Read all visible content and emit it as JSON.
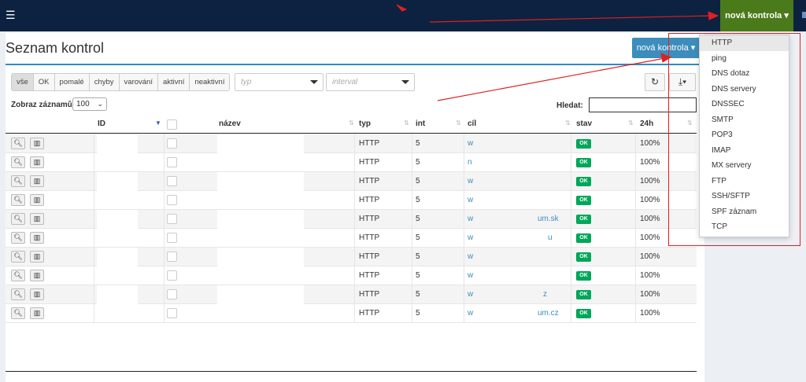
{
  "header": {
    "menu_icon": "hamburger-icon",
    "new_check_label": "nová kontrola",
    "chevron_icon": "chevron-down-icon"
  },
  "page": {
    "title": "Seznam kontrol",
    "new_check_button": "nová kontrola ▾"
  },
  "filters": [
    "vše",
    "OK",
    "pomalé",
    "chyby",
    "varování",
    "aktivní",
    "neaktivní"
  ],
  "active_filter": "vše",
  "selects": {
    "type_placeholder": "typ",
    "interval_placeholder": "interval"
  },
  "toolbar_icons": [
    "refresh-icon",
    "download-icon"
  ],
  "length": {
    "label": "Zobraz záznamů",
    "value": "100"
  },
  "search": {
    "label": "Hledat:",
    "value": ""
  },
  "table": {
    "columns": [
      "ID",
      "název",
      "typ",
      "int",
      "cíl",
      "stav",
      "24h"
    ],
    "rows": [
      {
        "typ": "HTTP",
        "int": "5",
        "cil": "w",
        "cil_suffix": "",
        "stav": "OK",
        "h24": "100%"
      },
      {
        "typ": "HTTP",
        "int": "5",
        "cil": "n",
        "cil_suffix": "",
        "stav": "OK",
        "h24": "100%"
      },
      {
        "typ": "HTTP",
        "int": "5",
        "cil": "w",
        "cil_suffix": "",
        "stav": "OK",
        "h24": "100%"
      },
      {
        "typ": "HTTP",
        "int": "5",
        "cil": "w",
        "cil_suffix": "",
        "stav": "OK",
        "h24": "100%"
      },
      {
        "typ": "HTTP",
        "int": "5",
        "cil": "w",
        "cil_suffix": "um.sk",
        "stav": "OK",
        "h24": "100%"
      },
      {
        "typ": "HTTP",
        "int": "5",
        "cil": "w",
        "cil_suffix": "u",
        "stav": "OK",
        "h24": "100%"
      },
      {
        "typ": "HTTP",
        "int": "5",
        "cil": "w",
        "cil_suffix": "",
        "stav": "OK",
        "h24": "100%"
      },
      {
        "typ": "HTTP",
        "int": "5",
        "cil": "w",
        "cil_suffix": "",
        "stav": "OK",
        "h24": "100%"
      },
      {
        "typ": "HTTP",
        "int": "5",
        "cil": "w",
        "cil_suffix": "z",
        "stav": "OK",
        "h24": "100%"
      },
      {
        "typ": "HTTP",
        "int": "5",
        "cil": "w",
        "cil_suffix": "um.cz",
        "stav": "OK",
        "h24": "100%"
      }
    ]
  },
  "dropdown": {
    "items": [
      "HTTP",
      "ping",
      "DNS dotaz",
      "DNS servery",
      "DNSSEC",
      "SMTP",
      "POP3",
      "IMAP",
      "MX servery",
      "FTP",
      "SSH/SFTP",
      "SPF záznam",
      "TCP"
    ],
    "highlighted": "HTTP"
  },
  "colors": {
    "header_bg": "#0d2240",
    "new_check_bg": "#4a7a1a",
    "primary": "#3c8dbc",
    "ok_badge": "#00a65a",
    "annotation": "#e02020"
  }
}
